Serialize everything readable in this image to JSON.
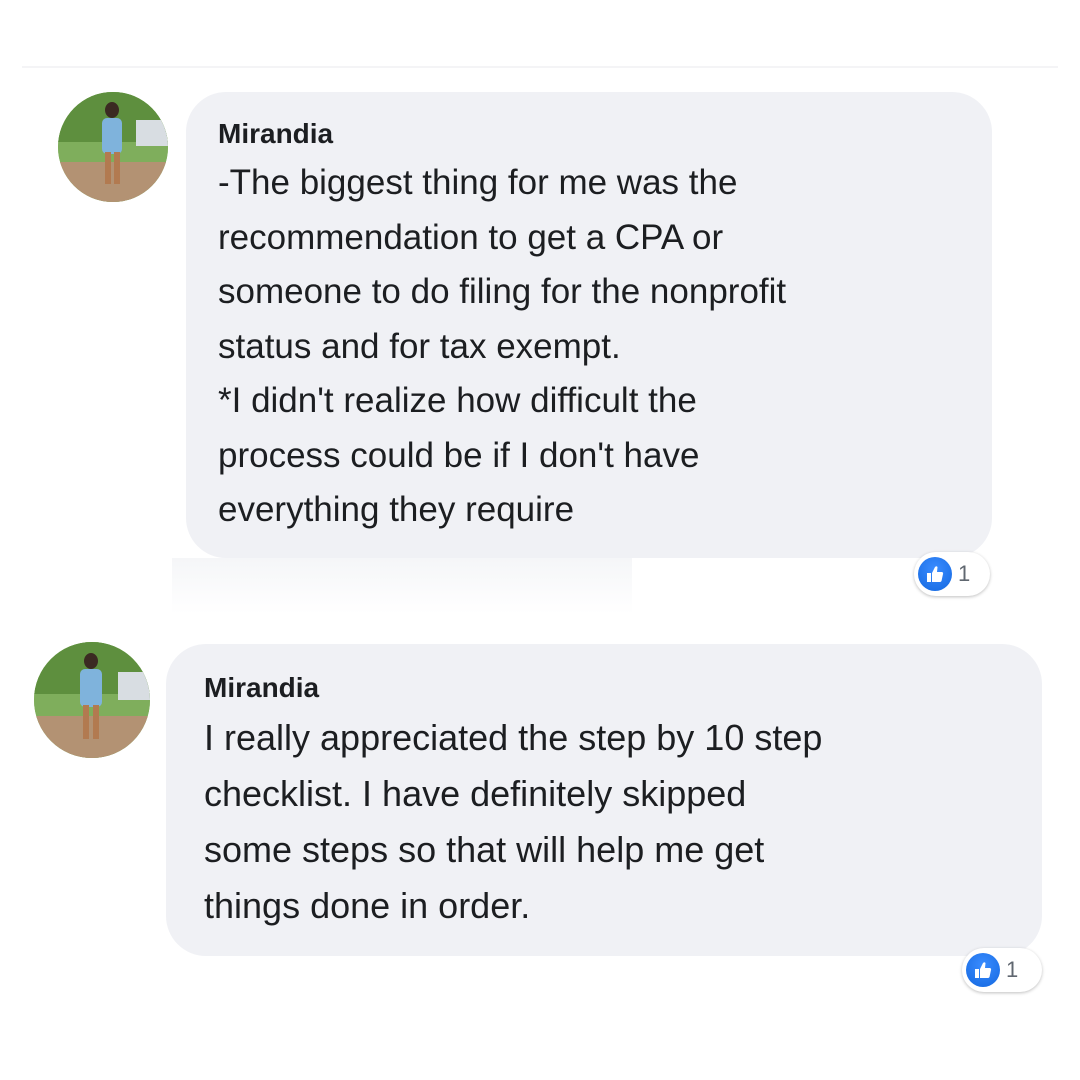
{
  "comments": [
    {
      "author": "Mirandia",
      "text": "-The biggest thing for me was the\nrecommendation to get a CPA or\nsomeone to do filing for the nonprofit\nstatus and for tax exempt.\n*I didn't realize how difficult the\nprocess could be if I don't have\neverything they require",
      "reaction_icon": "like-icon",
      "reaction_count": "1"
    },
    {
      "author": "Mirandia",
      "text": "I really appreciated the step by 10 step\nchecklist. I have definitely skipped\nsome steps so that will help me get\nthings done in order.",
      "reaction_icon": "like-icon",
      "reaction_count": "1"
    }
  ],
  "colors": {
    "bubble": "#f0f1f5",
    "like_blue": "#1877f2",
    "text": "#1c1e21"
  }
}
